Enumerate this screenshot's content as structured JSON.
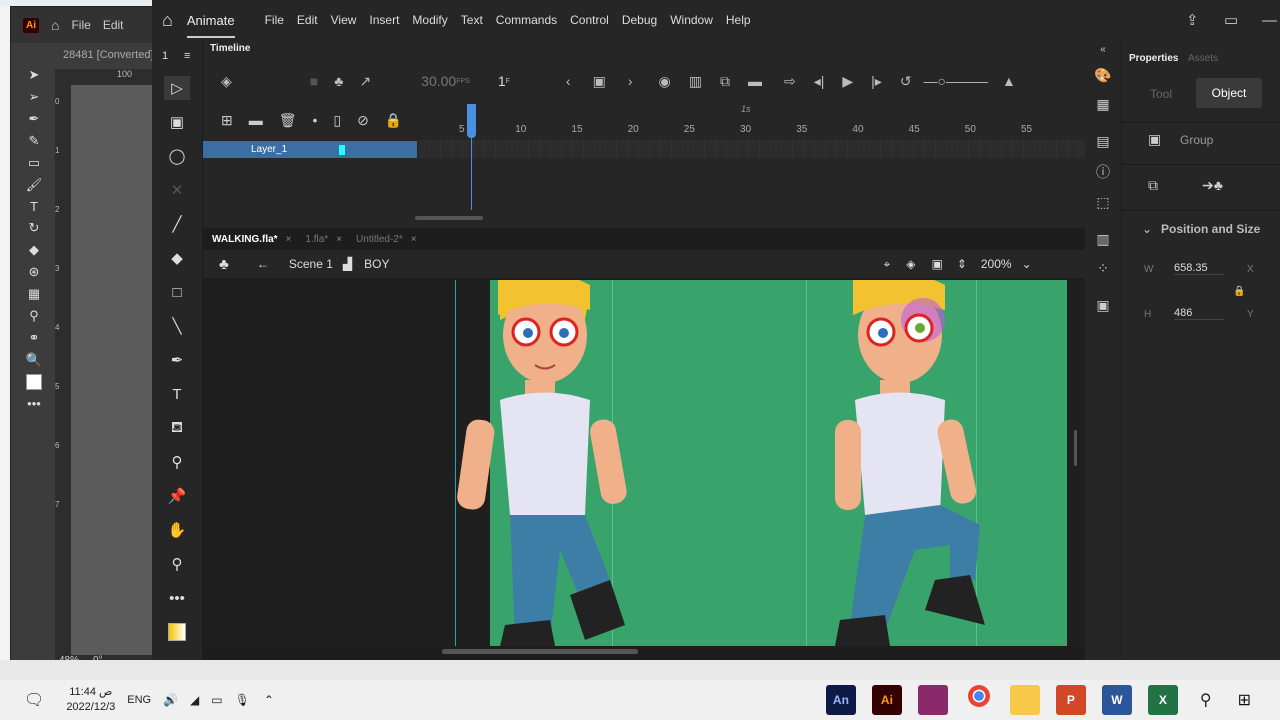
{
  "illustrator": {
    "logo": "Ai",
    "menu": [
      "File",
      "Edit"
    ],
    "doc_title": "28481 [Converted]",
    "ruler_label": "100",
    "zoom": "48%",
    "rotation": "0°",
    "vruler": [
      "0",
      "1",
      "2",
      "3",
      "4",
      "5",
      "6",
      "7"
    ]
  },
  "menubar": {
    "app": "Animate",
    "items": [
      "File",
      "Edit",
      "View",
      "Insert",
      "Modify",
      "Text",
      "Commands",
      "Control",
      "Debug",
      "Window",
      "Help"
    ]
  },
  "timeline": {
    "title": "Timeline",
    "fps": "30.00",
    "fps_unit": "FPS",
    "frame": "1",
    "frame_unit": "F",
    "second_marker": "1s",
    "frame_numbers": [
      "5",
      "10",
      "15",
      "20",
      "25",
      "30",
      "35",
      "40",
      "45",
      "50",
      "55"
    ],
    "layer": "Layer_1",
    "panel_number": "1"
  },
  "doc_tabs": [
    {
      "label": "WALKING.fla*",
      "active": true
    },
    {
      "label": "1.fla*",
      "active": false
    },
    {
      "label": "Untitled-2*",
      "active": false
    }
  ],
  "scene_bar": {
    "scene": "Scene 1",
    "symbol": "BOY",
    "zoom": "200%"
  },
  "properties": {
    "tabs": [
      "Properties",
      "Assets"
    ],
    "modes": [
      "Tool",
      "Object"
    ],
    "object_type": "Group",
    "section": "Position and Size",
    "w_label": "W",
    "w": "658.35",
    "h_label": "H",
    "h": "486",
    "x_label": "X",
    "y_label": "Y"
  },
  "taskbar": {
    "time": "11:44 ص",
    "date": "2022/12/3",
    "lang": "ENG",
    "apps": [
      "An",
      "Ai",
      "WinRAR",
      "Chrome",
      "Explorer",
      "PowerPoint",
      "Word",
      "Excel"
    ]
  },
  "colors": {
    "stage": "#38a46c",
    "accent": "#3a6ea5",
    "playhead": "#4a90e2"
  }
}
